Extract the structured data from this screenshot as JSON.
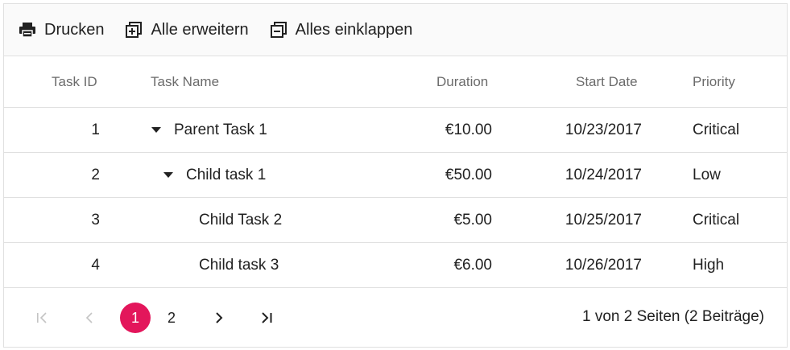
{
  "toolbar": {
    "print_label": "Drucken",
    "expand_label": "Alle erweitern",
    "collapse_label": "Alles einklappen"
  },
  "columns": {
    "task_id": "Task ID",
    "task_name": "Task Name",
    "duration": "Duration",
    "start_date": "Start Date",
    "priority": "Priority"
  },
  "rows": [
    {
      "id": "1",
      "name": "Parent Task 1",
      "duration": "€10.00",
      "start": "10/23/2017",
      "priority": "Critical"
    },
    {
      "id": "2",
      "name": "Child task 1",
      "duration": "€50.00",
      "start": "10/24/2017",
      "priority": "Low"
    },
    {
      "id": "3",
      "name": "Child Task 2",
      "duration": "€5.00",
      "start": "10/25/2017",
      "priority": "Critical"
    },
    {
      "id": "4",
      "name": "Child task 3",
      "duration": "€6.00",
      "start": "10/26/2017",
      "priority": "High"
    }
  ],
  "pager": {
    "pages": [
      "1",
      "2"
    ],
    "current_page": "1",
    "info": "1 von 2 Seiten (2 Beiträge)"
  },
  "colors": {
    "accent": "#e3165b",
    "border": "#e0e0e0",
    "toolbar_bg": "#fafafa"
  }
}
